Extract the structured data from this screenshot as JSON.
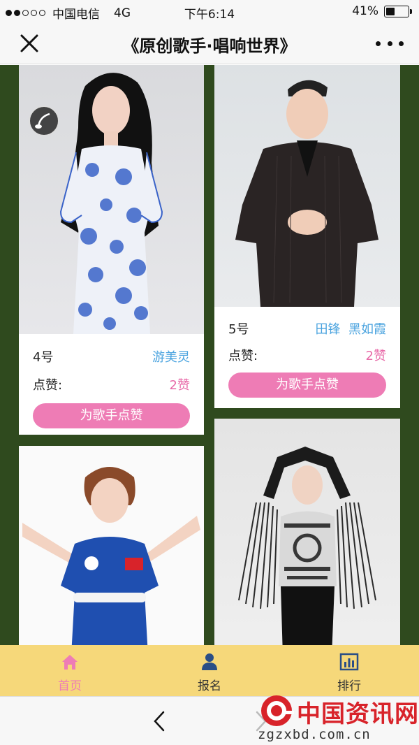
{
  "status": {
    "carrier": "中国电信",
    "network": "4G",
    "time": "下午6:14",
    "battery": "41%",
    "battery_level": 0.41,
    "signal_bars": 2
  },
  "nav": {
    "title": "《原创歌手·唱响世界》"
  },
  "cards": [
    {
      "number": "4号",
      "name": "游美灵",
      "likes_label": "点赞:",
      "likes": "2赞",
      "button": "为歌手点赞"
    },
    {
      "number": "5号",
      "name": "田锋  黑如霞",
      "likes_label": "点赞:",
      "likes": "2赞",
      "button": "为歌手点赞"
    }
  ],
  "tabs": [
    {
      "label": "首页",
      "icon": "home-icon",
      "active": true
    },
    {
      "label": "报名",
      "icon": "user-icon",
      "active": false
    },
    {
      "label": "排行",
      "icon": "chart-icon",
      "active": false
    }
  ],
  "watermark": {
    "title": "中国资讯网",
    "url": "zgzxbd.com.cn"
  },
  "colors": {
    "accent": "#ee7cb5",
    "name": "#4aa3df",
    "background": "#2f4a1e",
    "tabbar": "#f6d87a"
  }
}
